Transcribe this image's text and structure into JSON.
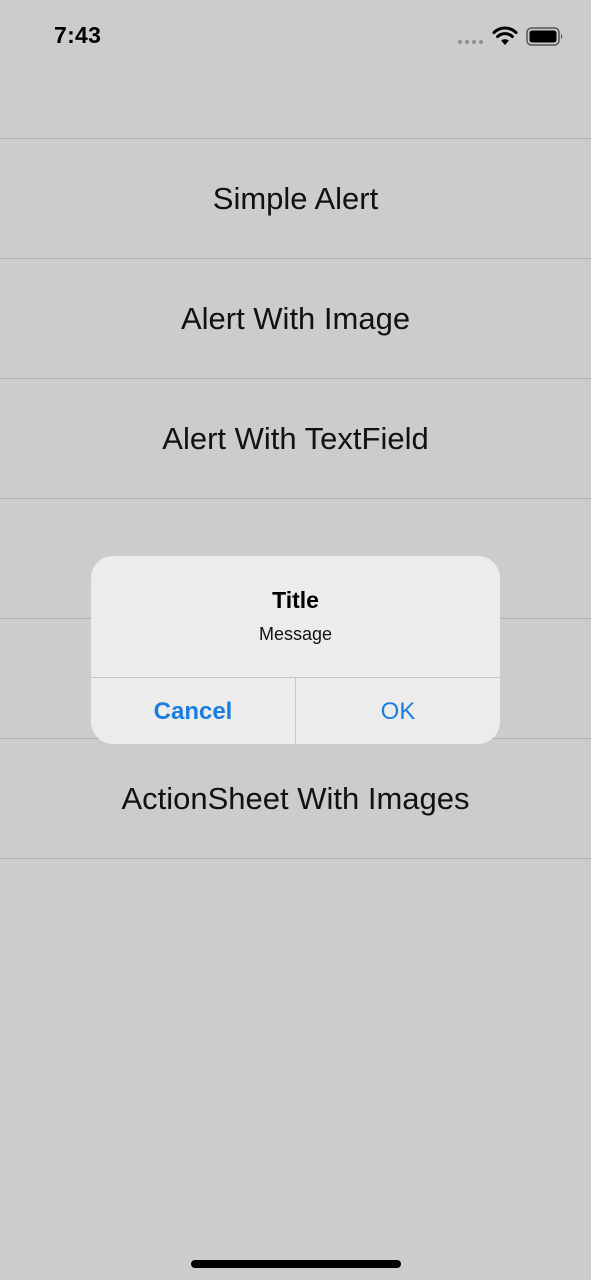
{
  "status_bar": {
    "time": "7:43"
  },
  "list": {
    "items": [
      {
        "label": "Simple Alert"
      },
      {
        "label": "Alert With Image"
      },
      {
        "label": "Alert With TextField"
      },
      {
        "label": ""
      },
      {
        "label": ""
      },
      {
        "label": "ActionSheet With Images"
      }
    ]
  },
  "alert": {
    "title": "Title",
    "message": "Message",
    "cancel_label": "Cancel",
    "ok_label": "OK"
  },
  "colors": {
    "background": "#cccccc",
    "alert_background": "#ececec",
    "action_blue": "#1a7ee0"
  },
  "icons": [
    "signal-dots-icon",
    "wifi-icon",
    "battery-icon"
  ]
}
